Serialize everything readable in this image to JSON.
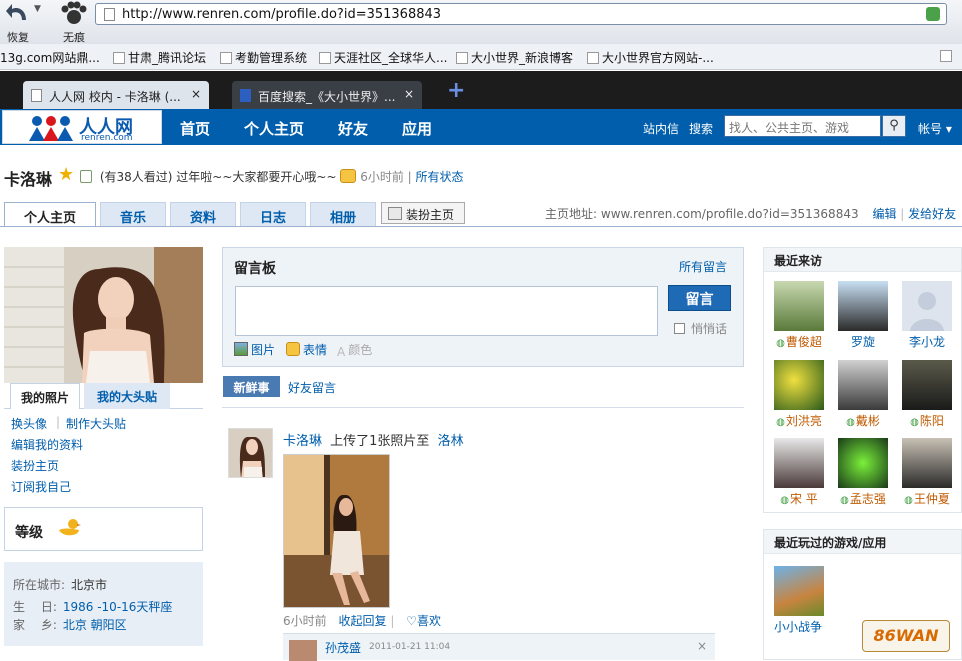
{
  "browser": {
    "back_label": "恢复",
    "home_label": "无痕",
    "url": "http://www.renren.com/profile.do?id=351368843",
    "bookmarks": [
      "13g.com网站鼎...",
      "甘肃_腾讯论坛",
      "考勤管理系统",
      "天涯社区_全球华人...",
      "大小世界_新浪博客",
      "大小世界官方网站-..."
    ],
    "tabs": [
      {
        "title": "人人网 校内 - 卡洛琳 (...",
        "close": "×"
      },
      {
        "title": "百度搜索_《大小世界》...",
        "close": "×"
      }
    ],
    "new_tab": "+"
  },
  "site": {
    "logo_cn": "人人网",
    "logo_en": "renren.com",
    "nav": [
      "首页",
      "个人主页",
      "好友",
      "应用"
    ],
    "right_links": [
      "站内信",
      "搜索"
    ],
    "search_placeholder": "找人、公共主页、游戏",
    "account": "帐号 ▾",
    "search_icon": "magnifier-icon"
  },
  "profile": {
    "name": "卡洛琳",
    "views": "(有38人看过)",
    "status_text": "过年啦~~大家都要开心哦~~",
    "status_time": "6小时前",
    "all_status": "所有状态",
    "tabs": [
      "个人主页",
      "音乐",
      "资料",
      "日志",
      "相册"
    ],
    "decorate": "装扮主页",
    "page_url_label": "主页地址:",
    "page_url": "www.renren.com/profile.do?id=351368843",
    "edit": "编辑",
    "share": "发给好友"
  },
  "left": {
    "photo_tabs": [
      "我的照片",
      "我的大头贴"
    ],
    "links": [
      "换头像",
      "制作大头贴",
      "编辑我的资料",
      "装扮主页",
      "订阅我自己"
    ],
    "level_label": "等级",
    "info": [
      {
        "label": "所在城市:",
        "value": "北京市"
      },
      {
        "label": "生　 日:",
        "value": "1986 -10-16天秤座"
      },
      {
        "label": "家　 乡:",
        "value": "北京 朝阳区"
      }
    ]
  },
  "board": {
    "title": "留言板",
    "all": "所有留言",
    "send": "留言",
    "quiet": "悄悄话",
    "tools": [
      "图片",
      "表情",
      "颜色"
    ]
  },
  "feed": {
    "tabs": [
      "新鲜事",
      "好友留言"
    ],
    "author": "卡洛琳",
    "action": "上传了1张照片至",
    "album": "洛林",
    "time": "6小时前",
    "collapse": "收起回复",
    "like": "喜欢",
    "comment_name": "孙茂盛",
    "comment_time": "2011-01-21 11:04",
    "comment_close": "×"
  },
  "right": {
    "visits_title": "最近来访",
    "visitors": [
      "曹俊超",
      "罗旋",
      "李小龙",
      "刘洪亮",
      "戴彬",
      "陈阳",
      "宋 平",
      "孟志强",
      "王仲夏"
    ],
    "games_title": "最近玩过的游戏/应用",
    "game": "小小战争"
  },
  "watermark": "86WAN"
}
